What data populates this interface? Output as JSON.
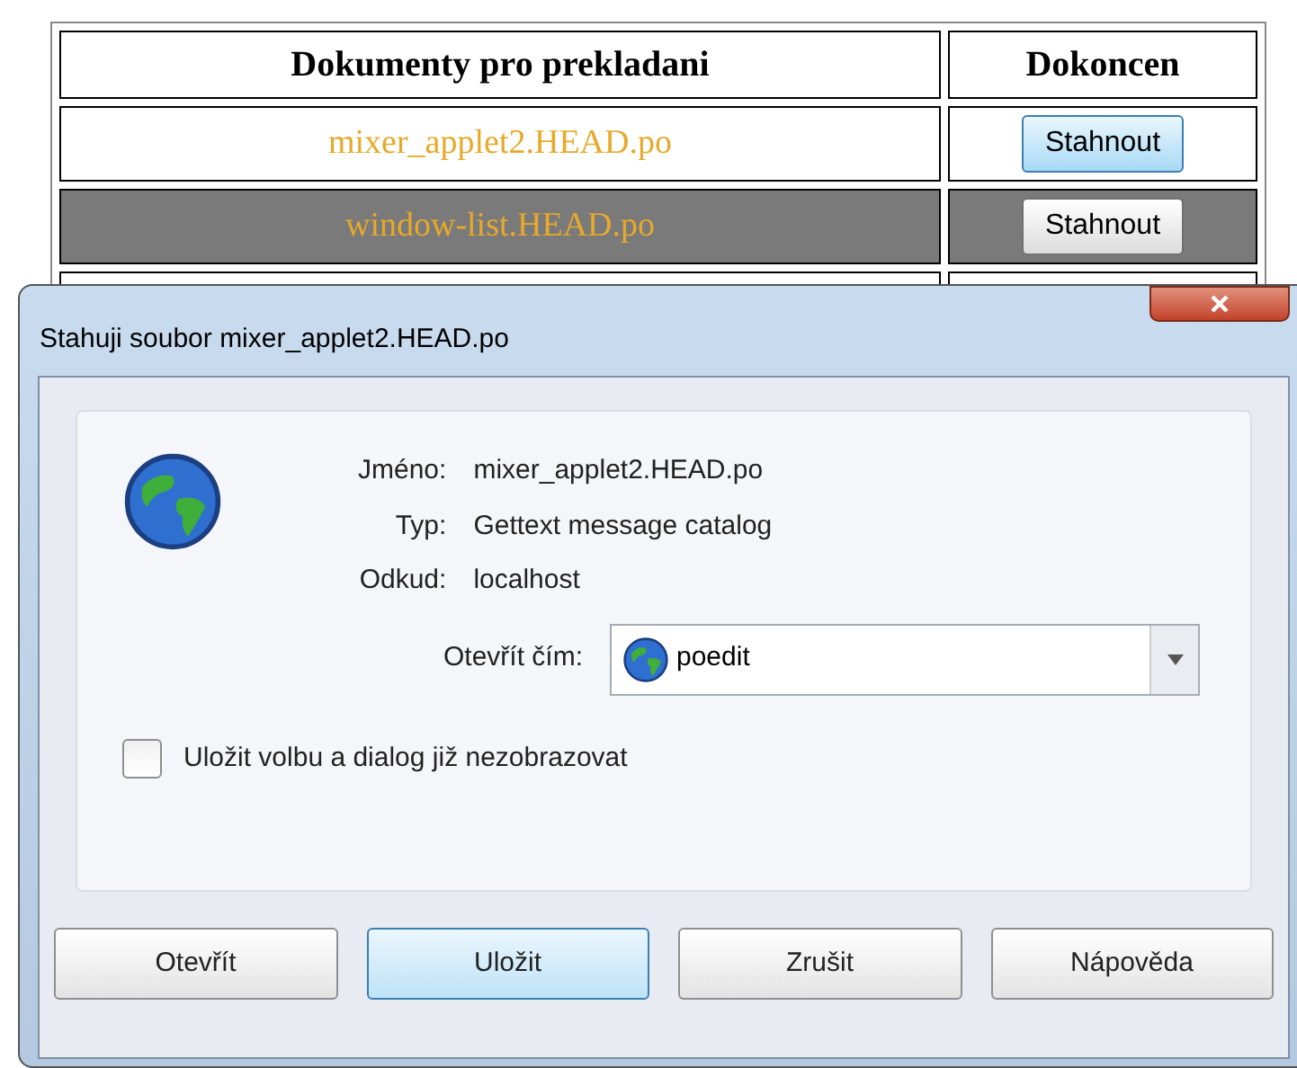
{
  "table": {
    "columns": [
      "Dokumenty pro prekladani",
      "Dokoncen"
    ],
    "rows": [
      {
        "file": "mixer_applet2.HEAD.po",
        "button": "Stahnout",
        "selected": false,
        "button_hovered": true
      },
      {
        "file": "window-list.HEAD.po",
        "button": "Stahnout",
        "selected": true,
        "button_hovered": false
      }
    ]
  },
  "dialog": {
    "title": "Stahuji soubor mixer_applet2.HEAD.po",
    "fields": [
      {
        "label": "Jméno:",
        "value": "mixer_applet2.HEAD.po"
      },
      {
        "label": "Typ:",
        "value": "Gettext message catalog"
      },
      {
        "label": "Odkud:",
        "value": "localhost"
      }
    ],
    "open_with": {
      "label": "Otevřít čím:",
      "value": "poedit"
    },
    "remember": {
      "label": "Uložit volbu a dialog již nezobrazovat",
      "checked": false
    },
    "buttons": [
      {
        "label": "Otevřít",
        "default": false
      },
      {
        "label": "Uložit",
        "default": true
      },
      {
        "label": "Zrušit",
        "default": false
      },
      {
        "label": "Nápověda",
        "default": false
      }
    ]
  }
}
